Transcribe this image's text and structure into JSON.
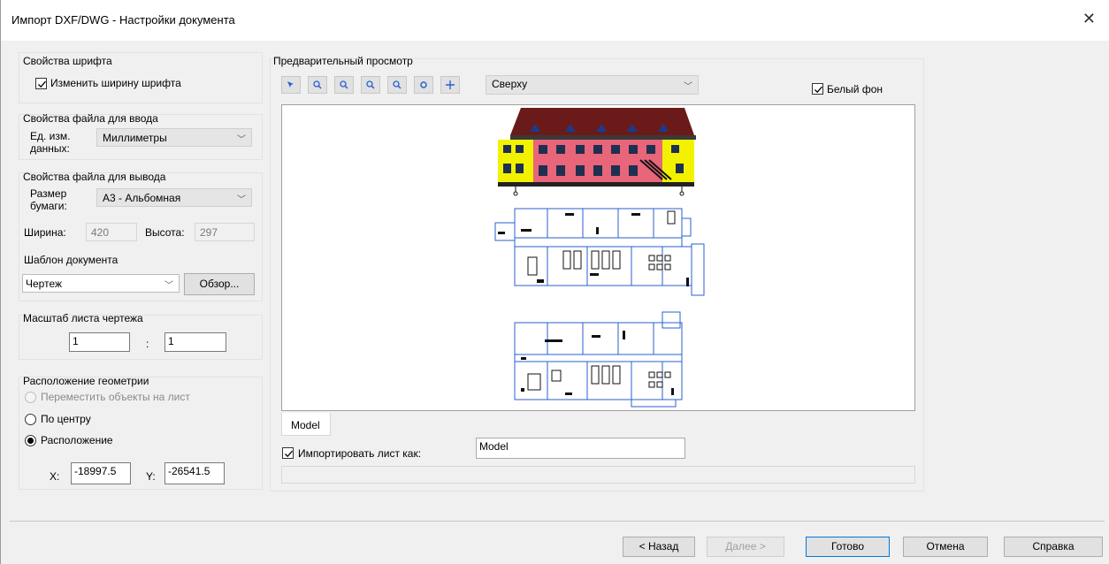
{
  "window": {
    "title": "Импорт DXF/DWG - Настройки документа",
    "close_icon": "close-icon"
  },
  "font_props": {
    "title": "Свойства шрифта",
    "change_width_label": "Изменить ширину шрифта",
    "change_width_checked": true
  },
  "input_file": {
    "title": "Свойства файла для ввода",
    "units_label_1": "Ед. изм.",
    "units_label_2": "данных:",
    "units_value": "Миллиметры"
  },
  "output_file": {
    "title": "Свойства файла для вывода",
    "paper_label_1": "Размер",
    "paper_label_2": "бумаги:",
    "paper_value": "А3 - Альбомная",
    "width_label": "Ширина:",
    "width_value": "420",
    "height_label": "Высота:",
    "height_value": "297",
    "template_label": "Шаблон документа",
    "template_value": "Чертеж",
    "browse_label": "Обзор..."
  },
  "scale": {
    "title": "Масштаб листа чертежа",
    "left": "1",
    "sep": ":",
    "right": "1"
  },
  "geometry": {
    "title": "Расположение геометрии",
    "option_move": "Переместить объекты на лист",
    "option_center": "По центру",
    "option_position": "Расположение",
    "selected": "position",
    "x_label": "X:",
    "x_value": "-18997.5",
    "y_label": "Y:",
    "y_value": "-26541.5"
  },
  "preview": {
    "title": "Предварительный просмотр",
    "tools": [
      "pointer-icon",
      "zoom-in-icon",
      "zoom-out-icon",
      "zoom-window-icon",
      "rotate-icon",
      "pan-icon"
    ],
    "view_value": "Сверху",
    "white_bg_label": "Белый фон",
    "white_bg_checked": true,
    "sheet_tab": "Model",
    "import_sheet_label": "Импортировать лист как:",
    "import_sheet_checked": true,
    "import_sheet_value": "Model"
  },
  "buttons": {
    "back": "< Назад",
    "next": "Далее >",
    "finish": "Готово",
    "cancel": "Отмена",
    "help": "Справка"
  },
  "colors": {
    "roof": "#6b1a1a",
    "wall_pink": "#e8657a",
    "wall_yellow": "#f2f200",
    "plan_blue": "#2a5fd0",
    "accent": "#0078d7"
  }
}
